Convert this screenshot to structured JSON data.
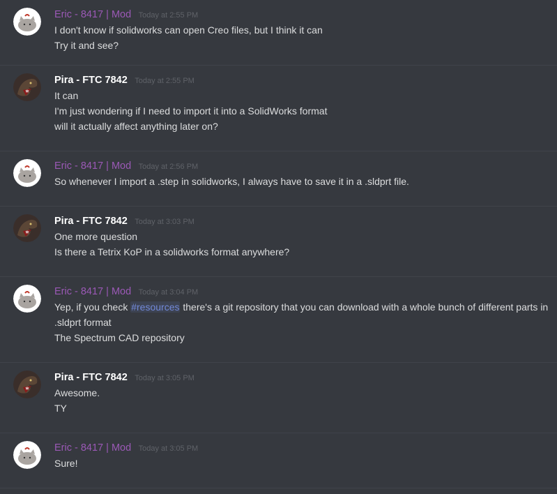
{
  "colors": {
    "background": "#36393f",
    "divider": "#40434a",
    "mod_name": "#9b59b6",
    "user_name": "#ffffff",
    "message_text": "#dcddde",
    "timestamp": "#5f6268",
    "channel_mention": "#7289da"
  },
  "messages": [
    {
      "author": "Eric - 8417 | Mod",
      "role": "mod",
      "avatar_icon": "pusheen-cat-avatar-icon",
      "timestamp": "Today at 2:55 PM",
      "lines": [
        "I don't know if solidworks can open Creo files, but I think it can",
        "Try it and see?"
      ]
    },
    {
      "author": "Pira - FTC 7842",
      "role": "member",
      "avatar_icon": "dinosaur-avatar-icon",
      "timestamp": "Today at 2:55 PM",
      "lines": [
        "It can",
        "I'm just wondering if I need to import it into a SolidWorks format",
        "will it actually affect anything later on?"
      ]
    },
    {
      "author": "Eric - 8417 | Mod",
      "role": "mod",
      "avatar_icon": "pusheen-cat-avatar-icon",
      "timestamp": "Today at 2:56 PM",
      "lines": [
        "So whenever I import a .step in solidworks, I always have to save it in a .sldprt file."
      ]
    },
    {
      "author": "Pira - FTC 7842",
      "role": "member",
      "avatar_icon": "dinosaur-avatar-icon",
      "timestamp": "Today at 3:03 PM",
      "lines": [
        "One more question",
        "Is there a Tetrix KoP in a solidworks format anywhere?"
      ]
    },
    {
      "author": "Eric - 8417 | Mod",
      "role": "mod",
      "avatar_icon": "pusheen-cat-avatar-icon",
      "timestamp": "Today at 3:04 PM",
      "rich_line": {
        "before": "Yep, if you check ",
        "mention": "#resources",
        "after": " there's a git repository that you can download with a whole bunch of different parts in .sldprt format"
      },
      "lines": [
        "The Spectrum CAD repository"
      ]
    },
    {
      "author": "Pira - FTC 7842",
      "role": "member",
      "avatar_icon": "dinosaur-avatar-icon",
      "timestamp": "Today at 3:05 PM",
      "lines": [
        "Awesome.",
        "TY"
      ]
    },
    {
      "author": "Eric - 8417 | Mod",
      "role": "mod",
      "avatar_icon": "pusheen-cat-avatar-icon",
      "timestamp": "Today at 3:05 PM",
      "lines": [
        "Sure!"
      ]
    }
  ]
}
